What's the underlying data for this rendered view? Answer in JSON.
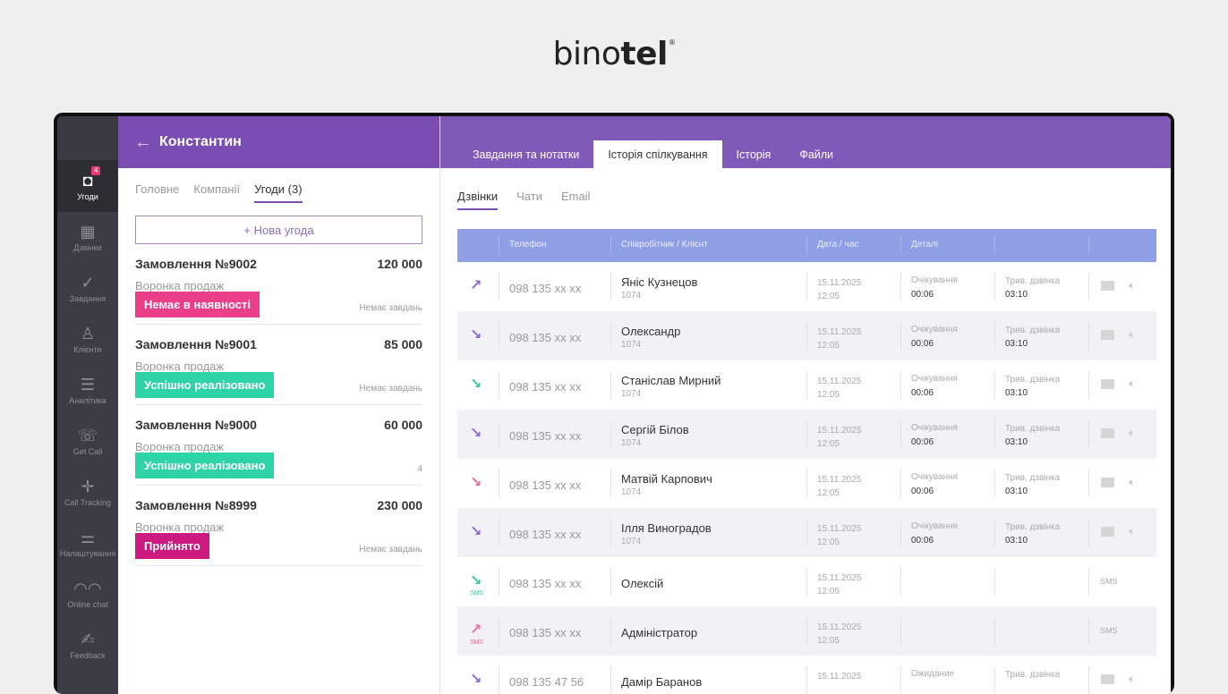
{
  "brand": {
    "name_light": "bino",
    "name_bold": "tel",
    "mark": "®"
  },
  "rail": [
    {
      "label": "Угоди",
      "icon": "deal-icon",
      "badge": "4",
      "active": true
    },
    {
      "label": "Дзвінки",
      "icon": "calls-icon"
    },
    {
      "label": "Завдання",
      "icon": "check-icon"
    },
    {
      "label": "Клієнти",
      "icon": "user-icon"
    },
    {
      "label": "Аналітика",
      "icon": "analytics-icon"
    },
    {
      "label": "Get Call",
      "icon": "getcall-icon"
    },
    {
      "label": "Call Tracking",
      "icon": "calltracking-icon"
    },
    {
      "label": "Налаштування",
      "icon": "settings-icon"
    },
    {
      "label": "Online chat",
      "icon": "chat-icon"
    },
    {
      "label": "Feedback",
      "icon": "feedback-icon"
    }
  ],
  "contact": {
    "name": "Константин"
  },
  "left_tabs": [
    "Головне",
    "Компанії",
    "Угоди (3)"
  ],
  "new_deal": "+ Нова угода",
  "deals": [
    {
      "title": "Замовлення №9002",
      "amount": "120 000",
      "funnel": "Воронка продаж",
      "status": "Немає в наявності",
      "status_color": "#ec3f8a",
      "note": "Немає завдань"
    },
    {
      "title": "Замовлення №9001",
      "amount": "85 000",
      "funnel": "Воронка продаж",
      "status": "Успішно реалізовано",
      "status_color": "#2ed3a7",
      "note": "Немає завдань"
    },
    {
      "title": "Замовлення №9000",
      "amount": "60 000",
      "funnel": "Воронка продаж",
      "status": "Успішно реалізовано",
      "status_color": "#2ed3a7",
      "note": "4"
    },
    {
      "title": "Замовлення №8999",
      "amount": "230 000",
      "funnel": "Воронка продаж",
      "status": "Прийнято",
      "status_color": "#cc1a80",
      "note": "Немає завдань"
    }
  ],
  "right_tabs": [
    "Завдання та нотатки",
    "Історія спілкування",
    "Історія",
    "Файли"
  ],
  "sub_tabs": [
    "Дзвінки",
    "Чати",
    "Email"
  ],
  "columns": [
    "Телефон",
    "Співробітник / Клієнт",
    "Дата / час",
    "Деталі"
  ],
  "calls": [
    {
      "dir": "↗",
      "color": "#9068d4",
      "phone": "098 135 xx xx",
      "name": "Яніс Кузнецов",
      "id": "1074",
      "date": "15.11.2025",
      "time": "12:05",
      "wait_label": "Очікування",
      "wait": "00:06",
      "dur_label": "Трив. дзвінка",
      "dur": "03:10"
    },
    {
      "dir": "↘",
      "color": "#9068d4",
      "phone": "098 135 xx xx",
      "name": "Олександр",
      "id": "1074",
      "date": "15.11.2025",
      "time": "12:05",
      "wait_label": "Очікування",
      "wait": "00:06",
      "dur_label": "Трив. дзвінка",
      "dur": "03:10"
    },
    {
      "dir": "↘",
      "color": "#39c9a0",
      "phone": "098 135 xx xx",
      "name": "Станіслав Мирний",
      "id": "1074",
      "date": "15.11.2025",
      "time": "12:05",
      "wait_label": "Очікування",
      "wait": "00:06",
      "dur_label": "Трив. дзвінка",
      "dur": "03:10"
    },
    {
      "dir": "↘",
      "color": "#9068d4",
      "phone": "098 135 xx xx",
      "name": "Сергій Білов",
      "id": "1074",
      "date": "15.11.2025",
      "time": "12:05",
      "wait_label": "Очікування",
      "wait": "00:06",
      "dur_label": "Трив. дзвінка",
      "dur": "03:10"
    },
    {
      "dir": "↘",
      "color": "#ef6a9a",
      "phone": "098 135 xx xx",
      "name": "Матвій Карпович",
      "id": "1074",
      "date": "15.11.2025",
      "time": "12:05",
      "wait_label": "Очікування",
      "wait": "00:06",
      "dur_label": "Трив. дзвінка",
      "dur": "03:10"
    },
    {
      "dir": "↘",
      "color": "#9068d4",
      "phone": "098 135 xx xx",
      "name": "Ілля Виноградов",
      "id": "1074",
      "date": "15.11.2025",
      "time": "12:05",
      "wait_label": "Очікування",
      "wait": "00:06",
      "dur_label": "Трив. дзвінка",
      "dur": "03:10"
    },
    {
      "dir": "↘",
      "color": "#39c9a0",
      "phone": "098 135 xx xx",
      "name": "Олексій",
      "id": "",
      "date": "15.11.2025",
      "time": "12:05",
      "sms": "SMS"
    },
    {
      "dir": "↗",
      "color": "#ef6a9a",
      "phone": "098 135 xx xx",
      "name": "Адміністратор",
      "id": "",
      "date": "15.11.2025",
      "time": "12:05",
      "sms": "SMS"
    },
    {
      "dir": "↘",
      "color": "#9068d4",
      "phone": "098 135 47 56",
      "name": "Дамір Баранов",
      "id": "",
      "date": "15.11.2025",
      "time": "",
      "wait_label": "Ожидание",
      "wait": "",
      "dur_label": "Трив. дзвінка",
      "dur": ""
    }
  ]
}
